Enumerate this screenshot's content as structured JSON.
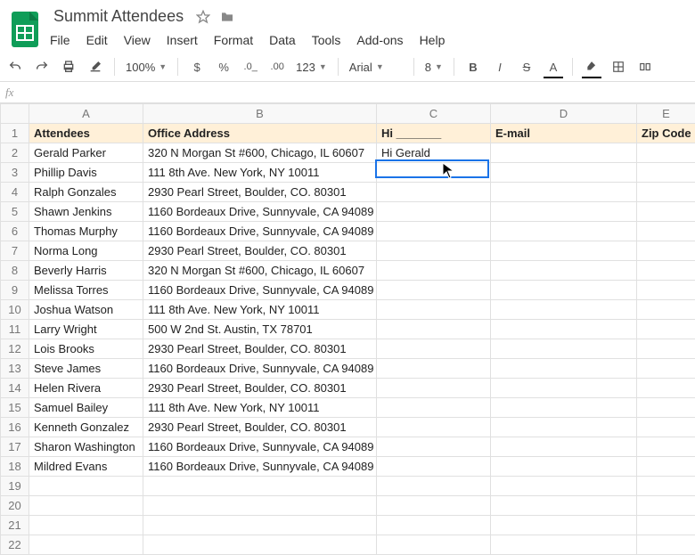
{
  "doc": {
    "title": "Summit Attendees"
  },
  "menu": [
    "File",
    "Edit",
    "View",
    "Insert",
    "Format",
    "Data",
    "Tools",
    "Add-ons",
    "Help"
  ],
  "toolbar": {
    "zoom": "100%",
    "num_format": "123",
    "font": "Arial",
    "font_size": "8",
    "currency": "$",
    "percent": "%"
  },
  "fx": {
    "label": "fx",
    "value": ""
  },
  "columns": [
    "",
    "A",
    "B",
    "C",
    "D",
    "E"
  ],
  "rows": [
    {
      "num": 1,
      "header": true,
      "cells": [
        "Attendees",
        "Office Address",
        "Hi _______",
        "E-mail",
        "Zip Code"
      ]
    },
    {
      "num": 2,
      "cells": [
        "Gerald Parker",
        "320 N Morgan St #600, Chicago, IL 60607",
        "Hi Gerald",
        "",
        ""
      ]
    },
    {
      "num": 3,
      "cells": [
        "Phillip Davis",
        "111 8th Ave. New York, NY 10011",
        "",
        "",
        ""
      ]
    },
    {
      "num": 4,
      "cells": [
        "Ralph Gonzales",
        "2930 Pearl Street, Boulder, CO. 80301",
        "",
        "",
        ""
      ]
    },
    {
      "num": 5,
      "cells": [
        "Shawn Jenkins",
        "1160 Bordeaux Drive, Sunnyvale, CA 94089",
        "",
        "",
        ""
      ]
    },
    {
      "num": 6,
      "cells": [
        "Thomas Murphy",
        "1160 Bordeaux Drive, Sunnyvale, CA 94089",
        "",
        "",
        ""
      ]
    },
    {
      "num": 7,
      "cells": [
        "Norma Long",
        "2930 Pearl Street, Boulder, CO. 80301",
        "",
        "",
        ""
      ]
    },
    {
      "num": 8,
      "cells": [
        "Beverly Harris",
        "320 N Morgan St #600, Chicago, IL 60607",
        "",
        "",
        ""
      ]
    },
    {
      "num": 9,
      "cells": [
        "Melissa Torres",
        "1160 Bordeaux Drive, Sunnyvale, CA 94089",
        "",
        "",
        ""
      ]
    },
    {
      "num": 10,
      "cells": [
        "Joshua Watson",
        "111 8th Ave. New York, NY 10011",
        "",
        "",
        ""
      ]
    },
    {
      "num": 11,
      "cells": [
        "Larry Wright",
        "500 W 2nd St. Austin, TX 78701",
        "",
        "",
        ""
      ]
    },
    {
      "num": 12,
      "cells": [
        "Lois Brooks",
        "2930 Pearl Street, Boulder, CO. 80301",
        "",
        "",
        ""
      ]
    },
    {
      "num": 13,
      "cells": [
        "Steve James",
        "1160 Bordeaux Drive, Sunnyvale, CA 94089",
        "",
        "",
        ""
      ]
    },
    {
      "num": 14,
      "cells": [
        "Helen Rivera",
        "2930 Pearl Street, Boulder, CO. 80301",
        "",
        "",
        ""
      ]
    },
    {
      "num": 15,
      "cells": [
        "Samuel Bailey",
        "111 8th Ave. New York, NY 10011",
        "",
        "",
        ""
      ]
    },
    {
      "num": 16,
      "cells": [
        "Kenneth Gonzalez",
        "2930 Pearl Street, Boulder, CO. 80301",
        "",
        "",
        ""
      ]
    },
    {
      "num": 17,
      "cells": [
        "Sharon Washington",
        "1160 Bordeaux Drive, Sunnyvale, CA 94089",
        "",
        "",
        ""
      ]
    },
    {
      "num": 18,
      "cells": [
        "Mildred Evans",
        "1160 Bordeaux Drive, Sunnyvale, CA 94089",
        "",
        "",
        ""
      ]
    },
    {
      "num": 19,
      "cells": [
        "",
        "",
        "",
        "",
        ""
      ]
    },
    {
      "num": 20,
      "cells": [
        "",
        "",
        "",
        "",
        ""
      ]
    },
    {
      "num": 21,
      "cells": [
        "",
        "",
        "",
        "",
        ""
      ]
    },
    {
      "num": 22,
      "cells": [
        "",
        "",
        "",
        "",
        ""
      ]
    }
  ],
  "selection": {
    "row": 3,
    "col": "C"
  }
}
